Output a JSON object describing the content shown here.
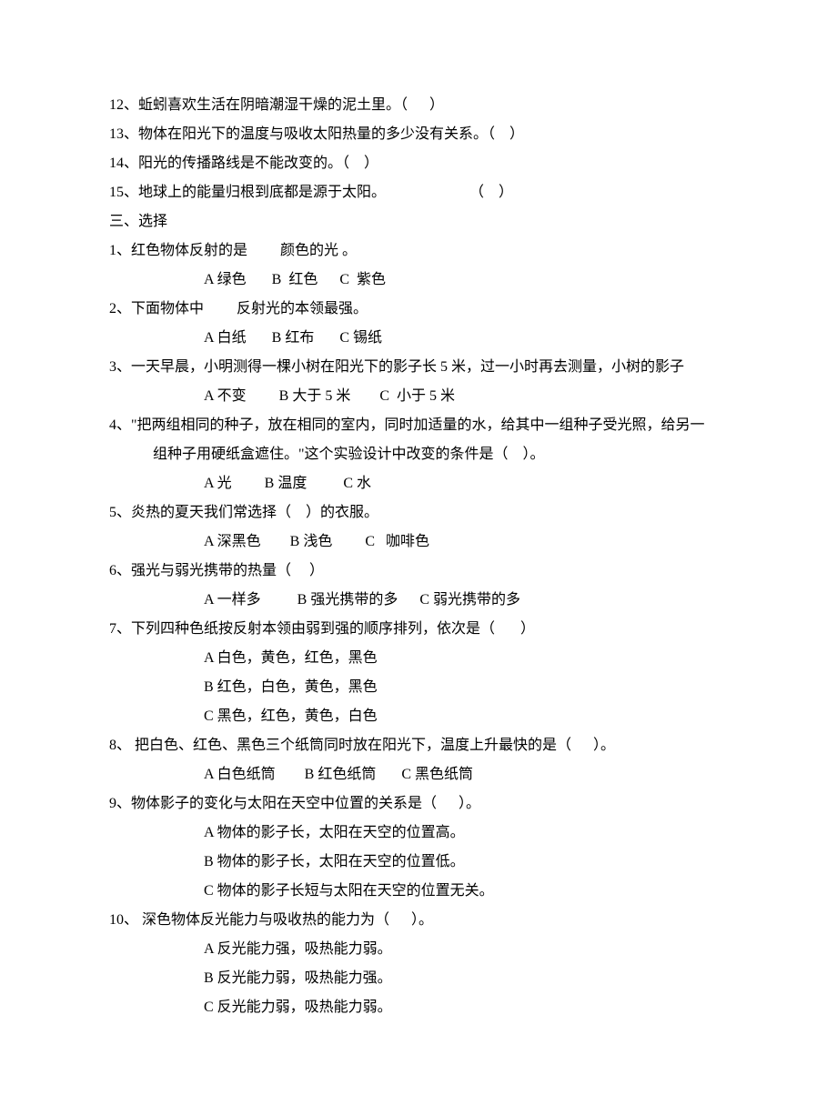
{
  "tf": {
    "q12": "12、蚯蚓喜欢生活在阴暗潮湿干燥的泥土里。（      ）",
    "q13": "13、物体在阳光下的温度与吸收太阳热量的多少没有关系。（    ）",
    "q14": "14、阳光的传播路线是不能改变的。（    ）",
    "q15": "15、地球上的能量归根到底都是源于太阳。                       （    ）"
  },
  "section3_title": "三、选择",
  "mc": {
    "q1": {
      "stem": "1、红色物体反射的是         颜色的光 。",
      "opts": "A 绿色       B  红色      C  紫色"
    },
    "q2": {
      "stem": "2、下面物体中         反射光的本领最强。",
      "opts": "A 白纸       B 红布       C 锡纸"
    },
    "q3": {
      "stem": "3、一天早晨，小明测得一棵小树在阳光下的影子长 5 米，过一小时再去测量，小树的影子",
      "opts": "A 不变         B 大于 5 米        C  小于 5 米"
    },
    "q4": {
      "stem1": "4、\"把两组相同的种子，放在相同的室内，同时加适量的水，给其中一组种子受光照，给另一",
      "stem2": "组种子用硬纸盒遮住。\"这个实验设计中改变的条件是（    ）。",
      "opts": "A 光         B 温度          C 水"
    },
    "q5": {
      "stem": "5、炎热的夏天我们常选择（    ）的衣服。",
      "opts": "A 深黑色        B 浅色         C   咖啡色"
    },
    "q6": {
      "stem": "6、强光与弱光携带的热量（     ）",
      "opts": "A 一样多          B 强光携带的多      C 弱光携带的多"
    },
    "q7": {
      "stem": "7、下列四种色纸按反射本领由弱到强的顺序排列，依次是（       ）",
      "optA": "A 白色，黄色，红色，黑色",
      "optB": "B 红色，白色，黄色，黑色",
      "optC": "C 黑色，红色，黄色，白色"
    },
    "q8": {
      "stem": "8、 把白色、红色、黑色三个纸筒同时放在阳光下，温度上升最快的是（      ）。",
      "opts": "A 白色纸筒        B 红色纸筒       C 黑色纸筒"
    },
    "q9": {
      "stem": "9、物体影子的变化与太阳在天空中位置的关系是（      ）。",
      "optA": "A 物体的影子长，太阳在天空的位置高。",
      "optB": "B 物体的影子长，太阳在天空的位置低。",
      "optC": "C 物体的影子长短与太阳在天空的位置无关。"
    },
    "q10": {
      "stem": "10、 深色物体反光能力与吸收热的能力为（      ）。",
      "optA": "A 反光能力强，吸热能力弱。",
      "optB": "B 反光能力弱，吸热能力强。",
      "optC": "C 反光能力弱，吸热能力弱。"
    }
  }
}
